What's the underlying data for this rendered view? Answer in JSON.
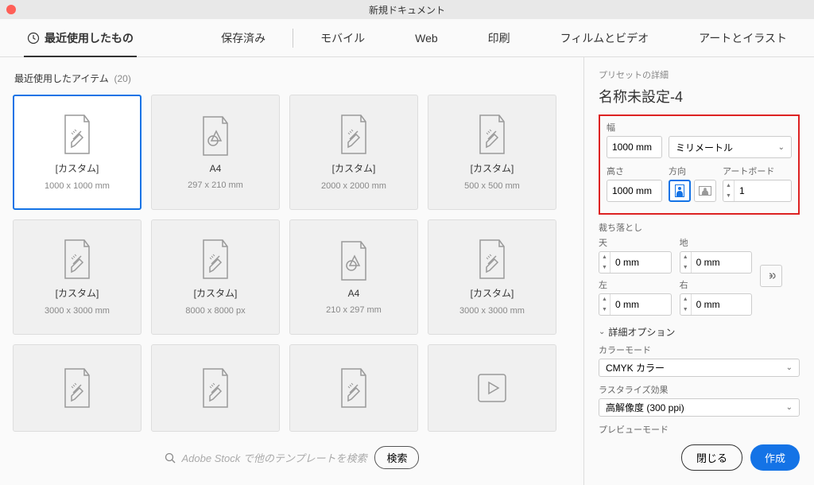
{
  "title": "新規ドキュメント",
  "tabs": {
    "recent": "最近使用したもの",
    "saved": "保存済み",
    "mobile": "モバイル",
    "web": "Web",
    "print": "印刷",
    "film": "フィルムとビデオ",
    "art": "アートとイラスト"
  },
  "section": {
    "title": "最近使用したアイテム",
    "count": "(20)"
  },
  "presets": [
    {
      "name": "[カスタム]",
      "size": "1000 x 1000 mm",
      "icon": "tools"
    },
    {
      "name": "A4",
      "size": "297 x 210 mm",
      "icon": "shape"
    },
    {
      "name": "[カスタム]",
      "size": "2000 x 2000 mm",
      "icon": "tools"
    },
    {
      "name": "[カスタム]",
      "size": "500 x 500 mm",
      "icon": "tools"
    },
    {
      "name": "[カスタム]",
      "size": "3000 x 3000 mm",
      "icon": "tools"
    },
    {
      "name": "[カスタム]",
      "size": "8000 x 8000 px",
      "icon": "tools"
    },
    {
      "name": "A4",
      "size": "210 x 297 mm",
      "icon": "shape"
    },
    {
      "name": "[カスタム]",
      "size": "3000 x 3000 mm",
      "icon": "tools"
    },
    {
      "name": "",
      "size": "",
      "icon": "tools"
    },
    {
      "name": "",
      "size": "",
      "icon": "tools"
    },
    {
      "name": "",
      "size": "",
      "icon": "tools"
    },
    {
      "name": "",
      "size": "",
      "icon": "play"
    }
  ],
  "search": {
    "placeholder": "Adobe Stock で他のテンプレートを検索",
    "btn": "検索"
  },
  "detail": {
    "head": "プリセットの詳細",
    "name": "名称未設定-4",
    "width_label": "幅",
    "width": "1000 mm",
    "unit": "ミリメートル",
    "height_label": "高さ",
    "height": "1000 mm",
    "orient_label": "方向",
    "artboard_label": "アートボード",
    "artboards": "1",
    "bleed_label": "裁ち落とし",
    "top": "天",
    "bottom": "地",
    "left": "左",
    "right": "右",
    "bleed_val": "0 mm",
    "adv": "詳細オプション",
    "colormode_label": "カラーモード",
    "colormode": "CMYK カラー",
    "raster_label": "ラスタライズ効果",
    "raster": "高解像度 (300 ppi)",
    "preview_label": "プレビューモード"
  },
  "footer": {
    "close": "閉じる",
    "create": "作成"
  }
}
